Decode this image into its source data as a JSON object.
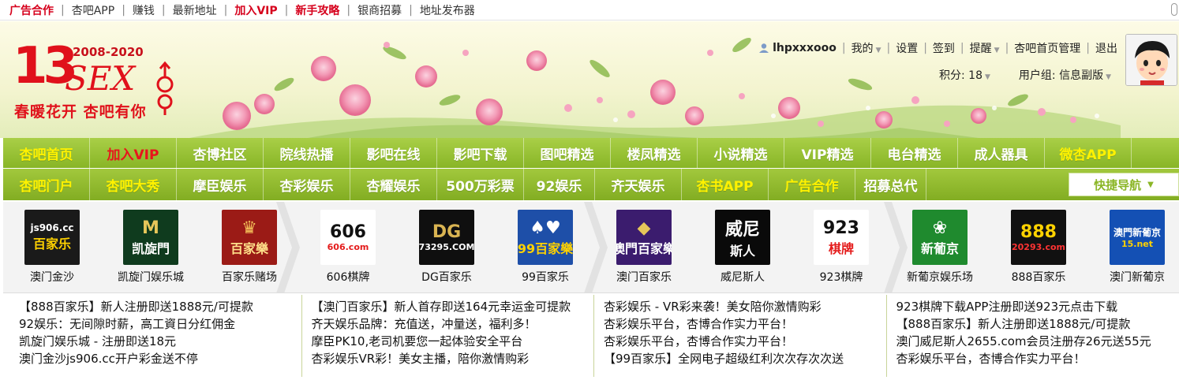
{
  "topbar": {
    "links": [
      {
        "label": "广告合作",
        "red": true
      },
      {
        "label": "杏吧APP",
        "red": false
      },
      {
        "label": "赚钱",
        "red": false
      },
      {
        "label": "最新地址",
        "red": false
      },
      {
        "label": "加入VIP",
        "red": true
      },
      {
        "label": "新手攻略",
        "red": true
      },
      {
        "label": "银商招募",
        "red": false
      },
      {
        "label": "地址发布器",
        "red": false
      }
    ],
    "separator": "|"
  },
  "logo": {
    "number": "13",
    "years": "2008-2020",
    "brand": "SEX",
    "slogan": "春暖花开 杏吧有你"
  },
  "user": {
    "username": "lhpxxxooo",
    "my": "我的",
    "settings": "设置",
    "checkin": "签到",
    "remind": "提醒",
    "manage": "杏吧首页管理",
    "logout": "退出",
    "points": "积分: 18",
    "group": "用户组: 信息副版"
  },
  "nav1": [
    {
      "label": "杏吧首页",
      "style": "active",
      "w": 110
    },
    {
      "label": "加入VIP",
      "style": "red",
      "w": 110
    },
    {
      "label": "杏博社区",
      "style": "",
      "w": 110
    },
    {
      "label": "院线热播",
      "style": "",
      "w": 110
    },
    {
      "label": "影吧在线",
      "style": "",
      "w": 110
    },
    {
      "label": "影吧下载",
      "style": "",
      "w": 110
    },
    {
      "label": "图吧精选",
      "style": "",
      "w": 110
    },
    {
      "label": "楼凤精选",
      "style": "",
      "w": 110
    },
    {
      "label": "小说精选",
      "style": "",
      "w": 110
    },
    {
      "label": "VIP精选",
      "style": "",
      "w": 110
    },
    {
      "label": "电台精选",
      "style": "",
      "w": 110
    },
    {
      "label": "成人器具",
      "style": "",
      "w": 110
    },
    {
      "label": "微杏APP",
      "style": "yellow",
      "w": 110
    }
  ],
  "nav2": [
    {
      "label": "杏吧门户",
      "style": "yellow",
      "w": 110
    },
    {
      "label": "杏吧大秀",
      "style": "yellow",
      "w": 110
    },
    {
      "label": "摩臣娱乐",
      "style": "",
      "w": 110
    },
    {
      "label": "杏彩娱乐",
      "style": "",
      "w": 110
    },
    {
      "label": "杏耀娱乐",
      "style": "",
      "w": 110
    },
    {
      "label": "500万彩票",
      "style": "",
      "w": 110
    },
    {
      "label": "92娱乐",
      "style": "",
      "w": 90
    },
    {
      "label": "齐天娱乐",
      "style": "",
      "w": 110
    },
    {
      "label": "杏书APP",
      "style": "yellow",
      "w": 110
    },
    {
      "label": "广告合作",
      "style": "yellow",
      "w": 110
    },
    {
      "label": "招募总代",
      "style": "",
      "w": 90
    }
  ],
  "quicknav": "快捷导航",
  "casinos": [
    {
      "caption": "澳门金沙",
      "l1": "js906.cc",
      "l2": "百家乐",
      "bg": "#1a1a1a",
      "c1": "#ffffff",
      "c2": "#ffd200"
    },
    {
      "caption": "凯旋门娱乐城",
      "l1": "M",
      "l2": "凯旋門",
      "bg": "#0f3b1e",
      "c1": "#e6c65a",
      "c2": "#ffffff"
    },
    {
      "caption": "百家乐赌场",
      "l1": "♛",
      "l2": "百家樂",
      "bg": "#9b1b16",
      "c1": "#f4c15a",
      "c2": "#ffe08a"
    },
    {
      "caption": "606棋牌",
      "l1": "606",
      "l2": "606.com",
      "bg": "#ffffff",
      "c1": "#111111",
      "c2": "#e41b1b"
    },
    {
      "caption": "DG百家乐",
      "l1": "DG",
      "l2": "73295.COM",
      "bg": "#0f0f0f",
      "c1": "#d9b452",
      "c2": "#ffffff"
    },
    {
      "caption": "99百家乐",
      "l1": "♠♥",
      "l2": "99百家樂",
      "bg": "#1e4fa8",
      "c1": "#ffffff",
      "c2": "#ffd200"
    },
    {
      "caption": "澳门百家乐",
      "l1": "◆",
      "l2": "澳門百家樂",
      "bg": "#3b1c6e",
      "c1": "#e6c65a",
      "c2": "#ffffff"
    },
    {
      "caption": "威尼斯人",
      "l1": "威尼",
      "l2": "斯人",
      "bg": "#0a0a0a",
      "c1": "#ffffff",
      "c2": "#ffffff"
    },
    {
      "caption": "923棋牌",
      "l1": "923",
      "l2": "棋牌",
      "bg": "#ffffff",
      "c1": "#111111",
      "c2": "#e41b1b"
    },
    {
      "caption": "新葡京娱乐场",
      "l1": "❀",
      "l2": "新葡京",
      "bg": "#1f8a2e",
      "c1": "#ffffff",
      "c2": "#ffffff"
    },
    {
      "caption": "888百家乐",
      "l1": "888",
      "l2": "20293.com",
      "bg": "#111111",
      "c1": "#ffd200",
      "c2": "#ff3333"
    },
    {
      "caption": "澳门新葡京",
      "l1": "澳門新葡京",
      "l2": "15.net",
      "bg": "#1450b4",
      "c1": "#ffffff",
      "c2": "#ffd200"
    }
  ],
  "ads": [
    [
      "【888百家乐】新人注册即送1888元/可提款",
      "92娱乐：无间隙时薪，高工資日分红佣金",
      "凯旋门娱乐城 - 注册即送18元",
      "澳门金沙js906.cc开户彩金送不停"
    ],
    [
      "【澳门百家乐】新人首存即送164元幸运金可提款",
      "齐天娱乐品牌：充值送，冲量送，福利多！",
      "摩臣PK10,老司机要您一起体验安全平台",
      "杏彩娱乐VR彩！美女主播，陪你激情购彩"
    ],
    [
      "杏彩娱乐 - VR彩来袭！美女陪你激情购彩",
      "杏彩娱乐平台，杏博合作实力平台！",
      "杏彩娱乐平台，杏博合作实力平台！",
      "【99百家乐】全网电子超级红利次次存次次送"
    ],
    [
      "923棋牌下载APP注册即送923元点击下载",
      "【888百家乐】新人注册即送1888元/可提款",
      "澳门威尼斯人2655.com会员注册存26元送55元",
      "杏彩娱乐平台，杏博合作实力平台！"
    ]
  ]
}
